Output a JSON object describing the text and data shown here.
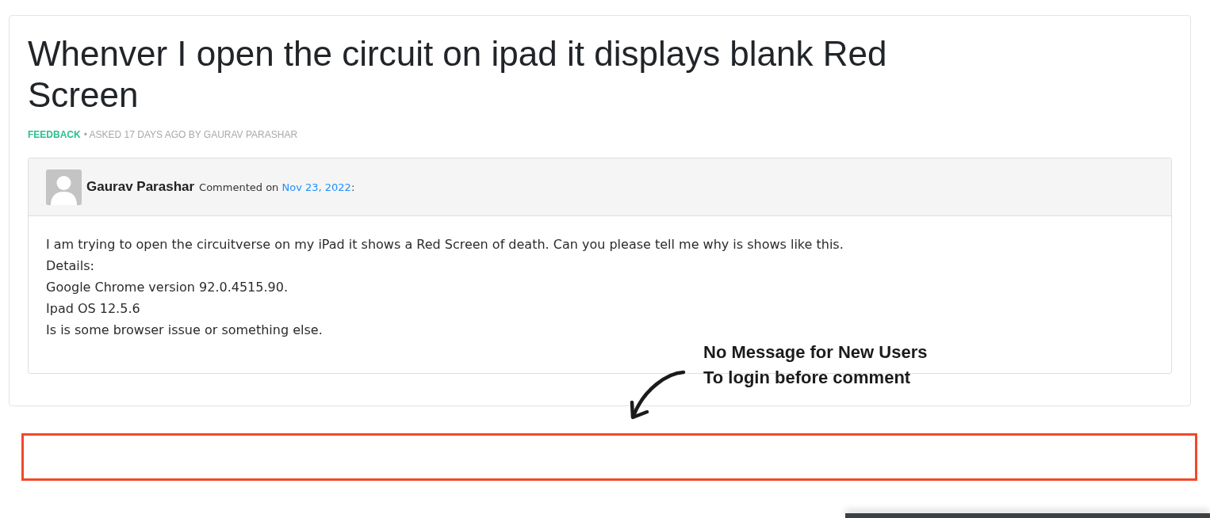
{
  "question": {
    "title": "Whenver I open the circuit on ipad it displays blank Red Screen",
    "category": "FEEDBACK",
    "meta": "• ASKED 17 DAYS AGO BY GAURAV PARASHAR"
  },
  "comment": {
    "author": "Gaurav Parashar",
    "action": "Commented on ",
    "date": "Nov 23, 2022",
    "suffix": ":",
    "lines": [
      "I am trying to open the circuitverse on my iPad it shows a Red Screen of death. Can you please tell me why is shows like this.",
      "Details:",
      "Google Chrome version 92.0.4515.90.",
      "Ipad OS 12.5.6",
      "Is is some browser issue or something else."
    ]
  },
  "annotation": {
    "lines": [
      "No Message for New Users",
      "To login before comment"
    ]
  }
}
